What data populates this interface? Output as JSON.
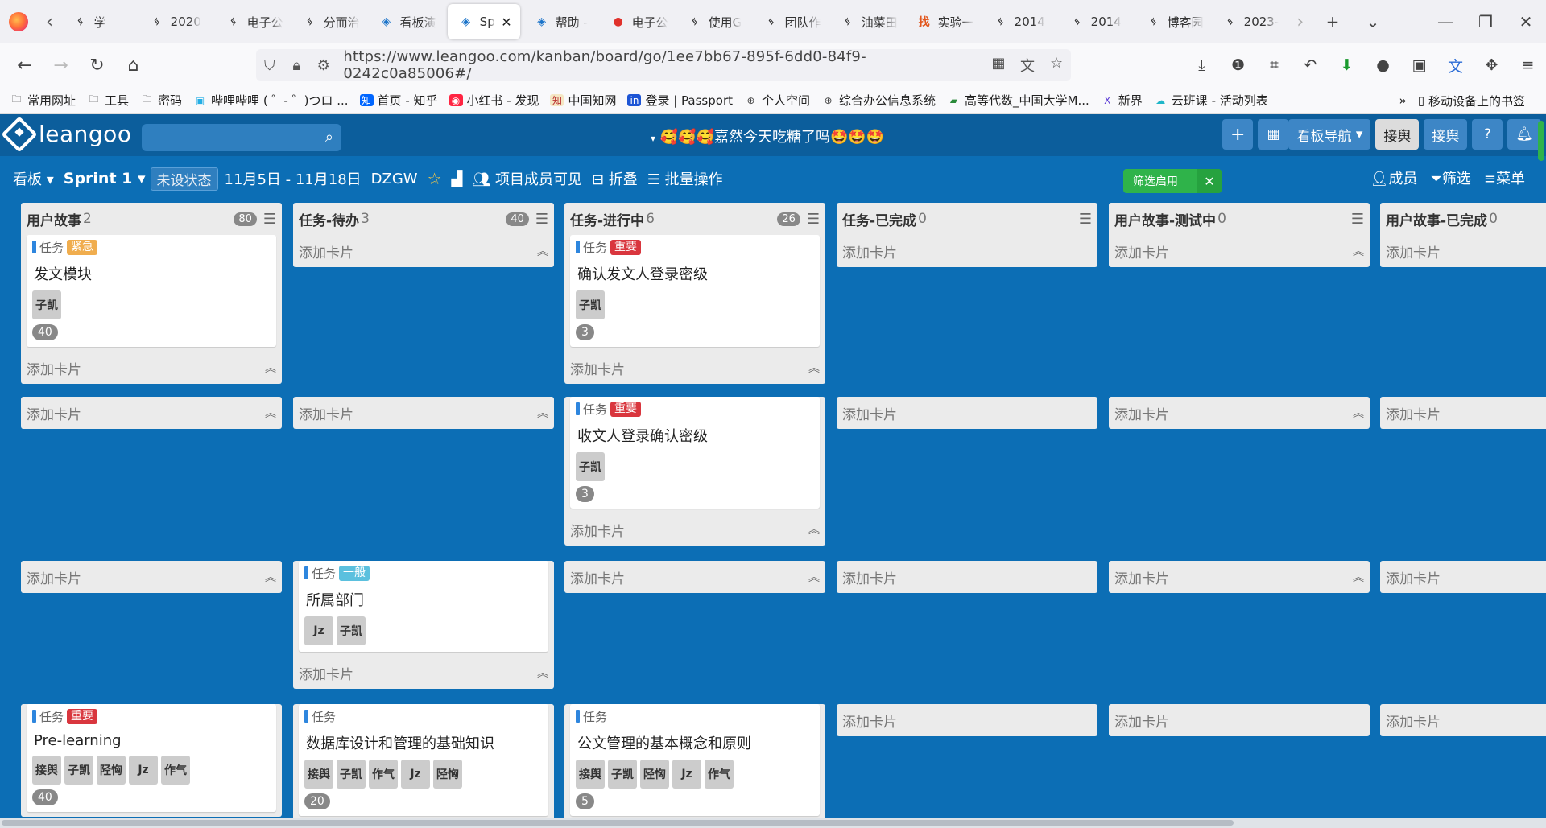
{
  "browser": {
    "tabs": [
      {
        "title": "学",
        "icon": "leangoo"
      },
      {
        "title": "2020",
        "icon": "leangoo"
      },
      {
        "title": "电子公",
        "icon": "leangoo"
      },
      {
        "title": "分而治",
        "icon": "leangoo"
      },
      {
        "title": "看板演",
        "icon": "diamond"
      },
      {
        "title": "Sp",
        "icon": "diamond",
        "active": true
      },
      {
        "title": "帮助 -",
        "icon": "diamond"
      },
      {
        "title": "电子公",
        "icon": "red-circle"
      },
      {
        "title": "使用G",
        "icon": "leangoo"
      },
      {
        "title": "团队作",
        "icon": "leangoo"
      },
      {
        "title": "油菜田",
        "icon": "leangoo"
      },
      {
        "title": "实验一",
        "icon": "orange-find"
      },
      {
        "title": "2014",
        "icon": "leangoo"
      },
      {
        "title": "2014",
        "icon": "leangoo"
      },
      {
        "title": "博客园",
        "icon": "leangoo"
      },
      {
        "title": "2023-",
        "icon": "leangoo"
      }
    ],
    "url": "https://www.leangoo.com/kanban/board/go/1ee7bb67-895f-6dd0-84f9-0242c0a85006#/",
    "bookmarks": [
      {
        "label": "常用网址",
        "icon": "folder"
      },
      {
        "label": "工具",
        "icon": "folder"
      },
      {
        "label": "密码",
        "icon": "folder"
      },
      {
        "label": "哔哩哔哩 ( ゜- ゜)つロ ...",
        "icon": "bilibili"
      },
      {
        "label": "首页 - 知乎",
        "icon": "zhihu"
      },
      {
        "label": "小红书 - 发现",
        "icon": "xiaohongshu"
      },
      {
        "label": "中国知网",
        "icon": "cnki"
      },
      {
        "label": "登录 | Passport",
        "icon": "passport"
      },
      {
        "label": "个人空间",
        "icon": "globe"
      },
      {
        "label": "综合办公信息系统",
        "icon": "globe"
      },
      {
        "label": "高等代数_中国大学M...",
        "icon": "mooc"
      },
      {
        "label": "新界",
        "icon": "x"
      },
      {
        "label": "云班课 - 活动列表",
        "icon": "cloud"
      }
    ],
    "mobile_bookmarks": "移动设备上的书签"
  },
  "app": {
    "logo": "leangoo",
    "board_title": "🥰🥰🥰嘉然今天吃糖了吗🤩🤩🤩",
    "header_buttons": {
      "nav": "看板导航",
      "user1": "接舆",
      "user2": "接舆",
      "help": "?"
    }
  },
  "sprint_bar": {
    "board_menu": "看板",
    "sprint": "Sprint 1",
    "state": "未设状态",
    "dates": "11月5日 - 11月18日",
    "code": "DZGW",
    "visibility": "项目成员可见",
    "fold": "折叠",
    "batch": "批量操作",
    "filter_chip": "筛选启用",
    "members": "成员",
    "filter": "筛选",
    "menu": "菜单"
  },
  "columns": [
    {
      "title": "用户故事",
      "count": "2",
      "wip": "80"
    },
    {
      "title": "任务-待办",
      "count": "3",
      "wip": "40"
    },
    {
      "title": "任务-进行中",
      "count": "6",
      "wip": "26"
    },
    {
      "title": "任务-已完成",
      "count": "0"
    },
    {
      "title": "用户故事-测试中",
      "count": "0"
    },
    {
      "title": "用户故事-已完成",
      "count": "0"
    }
  ],
  "add_card_label": "添加卡片",
  "card_type_label": "任务",
  "cards": {
    "r1c1": {
      "tag": "紧急",
      "title": "发文模块",
      "members": [
        "子凯"
      ],
      "points": "40"
    },
    "r1c3": {
      "tag": "重要",
      "title": "确认发文人登录密级",
      "members": [
        "子凯"
      ],
      "points": "3"
    },
    "r2c3": {
      "tag": "重要",
      "title": "收文人登录确认密级",
      "members": [
        "子凯"
      ],
      "points": "3"
    },
    "r3c2": {
      "tag": "一般",
      "title": "所属部门",
      "members": [
        "Jz",
        "子凯"
      ]
    },
    "r4c1": {
      "tag": "重要",
      "title": "Pre-learning",
      "members": [
        "接舆",
        "子凯",
        "陉恟",
        "Jz",
        "作气"
      ],
      "points": "40"
    },
    "r4c2": {
      "title": "数据库设计和管理的基础知识",
      "members": [
        "接舆",
        "子凯",
        "作气",
        "Jz",
        "陉恟"
      ],
      "points": "20"
    },
    "r4c3": {
      "title": "公文管理的基本概念和原则",
      "members": [
        "接舆",
        "子凯",
        "陉恟",
        "Jz",
        "作气"
      ],
      "points": "5"
    }
  },
  "colors": {
    "board_bg": "#0c6eb5",
    "header_bg": "#0c5e9c",
    "tag_urgent": "#f0ad4e",
    "tag_important": "#d9363e",
    "tag_normal": "#5bc0de",
    "filter_green": "#2fb34a"
  }
}
